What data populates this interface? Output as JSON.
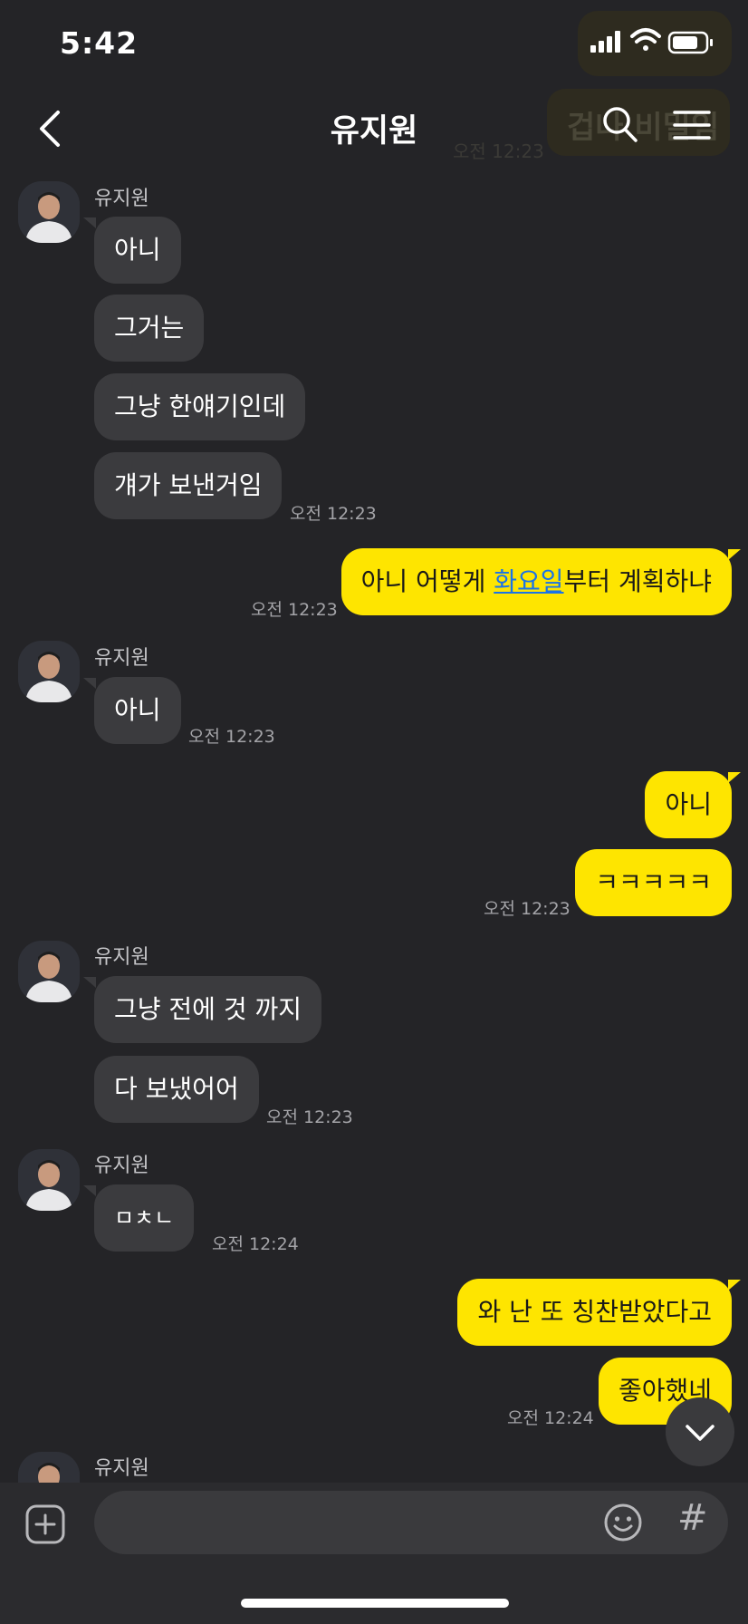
{
  "status": {
    "time": "5:42"
  },
  "background_hint": {
    "ghost_title": "겁나 비밀임",
    "ghost_time": "오전 12:23"
  },
  "header": {
    "title": "유지원"
  },
  "messages": {
    "g1": {
      "sender": "유지원",
      "b1": "아니",
      "b2": "그거는",
      "b3": "그냥 한얘기인데",
      "b4": "걔가 보낸거임",
      "time": "오전 12:23"
    },
    "o1": {
      "text_before": "아니 어떻게 ",
      "link": "화요일",
      "text_after": "부터 계획하냐",
      "time": "오전 12:23"
    },
    "g2": {
      "sender": "유지원",
      "b1": "아니",
      "time": "오전 12:23"
    },
    "o2": {
      "b1": "아니",
      "b2": "ㅋㅋㅋㅋㅋ",
      "time": "오전 12:23"
    },
    "g3": {
      "sender": "유지원",
      "b1": "그냥 전에 것 까지",
      "b2": "다 보냈어어",
      "time": "오전 12:23"
    },
    "g4": {
      "sender": "유지원",
      "b1": "ㅁㅊㄴ",
      "time": "오전 12:24"
    },
    "o3": {
      "b1": "와 난 또 칭찬받았다고",
      "b2": "좋아했네",
      "time": "오전 12:24"
    },
    "g5": {
      "sender": "유지원"
    }
  },
  "icons": {
    "back": "chevron-left-icon",
    "search": "search-icon",
    "menu": "hamburger-menu-icon",
    "scroll": "chevron-down-icon",
    "plus": "plus-square-icon",
    "emoji": "smiley-icon",
    "hash": "#"
  },
  "colors": {
    "background": "#242427",
    "incoming_bubble": "#3b3b3e",
    "outgoing_bubble": "#fee500",
    "link": "#1a73e8"
  }
}
